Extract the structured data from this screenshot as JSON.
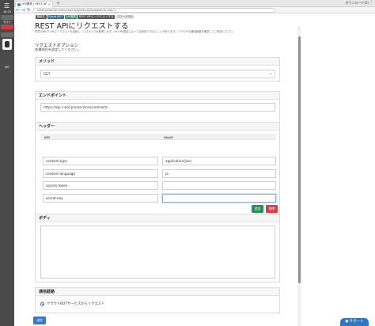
{
  "window": {
    "tab_title": "API連携 | REST APIにリクエ",
    "new_tab": "+",
    "downloads": "ダウンロード(0)",
    "address": "ctest-external.ccloud-bot.app/rest-api/request-to-rest-1"
  },
  "sidebar": {
    "time": "10:23",
    "labels": [
      "タスク",
      "",
      "SET"
    ]
  },
  "breadcrumb": {
    "items": [
      "機能名",
      "Cloud BOT",
      "API連携",
      "REST APIにリクエストする",
      "フローの流れ"
    ]
  },
  "page": {
    "title": "REST APIにリクエストする",
    "lead": "任意のREST APIにリクエストを送信し、レスポンスを取得します。※CORS設定によっては利用できないことがあります。ブラウザの通信経路を確認してご利用ください。",
    "section_title": "リクエストオプション",
    "section_sub": "各種項目を設定してください。"
  },
  "method": {
    "header": "メソッド",
    "value": "GET"
  },
  "endpoint": {
    "header": "エンドポイント",
    "value": "https://api.c-bot.pro/services/contracts"
  },
  "headers": {
    "header": "ヘッダー",
    "col_key": "KEY",
    "col_value": "VALUE",
    "rows": [
      {
        "key": "content-type",
        "value": "application/json"
      },
      {
        "key": "content-language",
        "value": "ja"
      },
      {
        "key": "access-token",
        "value": ""
      },
      {
        "key": "secret-key",
        "value": ""
      }
    ],
    "add_label": "追加",
    "delete_label": "削除"
  },
  "body": {
    "header": "ボディ"
  },
  "route": {
    "header": "通信経路",
    "option": "クラウドBOTサービスからリクエスト"
  },
  "submit_label": "送信",
  "support_label": "サポート"
}
